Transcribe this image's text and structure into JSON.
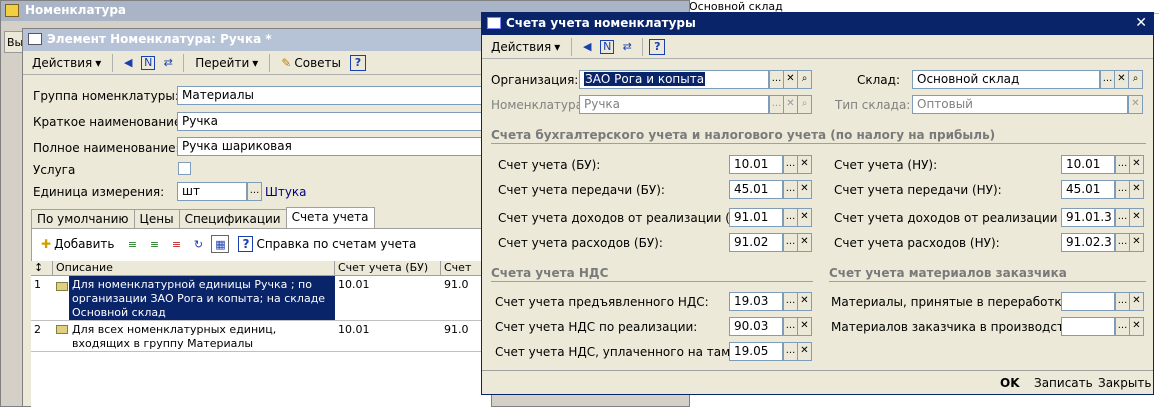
{
  "bg_window": {
    "title": "Номенклатура",
    "menu_partial": "Вы",
    "right_cell": "Основной склад"
  },
  "element_window": {
    "title": "Элемент Номенклатура: Ручка *",
    "toolbar": {
      "actions_label": "Действия",
      "goto_label": "Перейти",
      "tips_label": "Советы"
    },
    "fields": {
      "group_label": "Группа номенклатуры:",
      "group_value": "Материалы",
      "short_name_label": "Краткое наименование:",
      "short_name_value": "Ручка",
      "full_name_label": "Полное наименование:",
      "full_name_value": "Ручка шариковая",
      "service_label": "Услуга",
      "unit_label": "Единица измерения:",
      "unit_value": "шт",
      "unit_name": "Штука"
    },
    "tabs": [
      "По умолчанию",
      "Цены",
      "Спецификации",
      "Счета учета"
    ],
    "active_tab": 3,
    "accounts_toolbar": {
      "add_label": "Добавить",
      "help_label": "Справка по счетам учета"
    },
    "table": {
      "headers": [
        "Описание",
        "Счет учета (БУ)",
        "Счет"
      ],
      "rows": [
        {
          "num": "1",
          "desc": "Для номенклатурной единицы Ручка ; по организации ЗАО Рога и копыта; на складе Основной склад",
          "bu": "10.01",
          "nu": "91.0"
        },
        {
          "num": "2",
          "desc": "Для всех номенклатурных единиц, входящих в группу Материалы",
          "bu": "10.01",
          "nu": "91.0"
        }
      ]
    }
  },
  "dialog": {
    "title": "Счета учета номенклатуры",
    "toolbar": {
      "actions_label": "Действия"
    },
    "org_label": "Организация:",
    "org_value": "ЗАО Рога и копыта",
    "nom_label": "Номенклатура:",
    "nom_value": "Ручка",
    "warehouse_label": "Склад:",
    "warehouse_value": "Основной склад",
    "warehouse_type_label": "Тип склада:",
    "warehouse_type_value": "Оптовый",
    "section_accounting": "Счета бухгалтерского учета и налогового учета (по налогу на прибыль)",
    "bu_rows": [
      {
        "label": "Счет учета (БУ):",
        "value": "10.01"
      },
      {
        "label": "Счет учета передачи (БУ):",
        "value": "45.01"
      },
      {
        "label": "Счет учета доходов от реализации (БУ):",
        "value": "91.01"
      },
      {
        "label": "Счет учета расходов (БУ):",
        "value": "91.02"
      }
    ],
    "nu_rows": [
      {
        "label": "Счет учета (НУ):",
        "value": "10.01"
      },
      {
        "label": "Счет учета передачи (НУ):",
        "value": "45.01"
      },
      {
        "label": "Счет учета доходов от реализации (НУ):",
        "value": "91.01.3"
      },
      {
        "label": "Счет учета расходов (НУ):",
        "value": "91.02.3"
      }
    ],
    "section_vat": "Счета учета НДС",
    "vat_rows": [
      {
        "label": "Счет учета предъявленного НДС:",
        "value": "19.03"
      },
      {
        "label": "Счет учета НДС по реализации:",
        "value": "90.03"
      },
      {
        "label": "Счет учета НДС, уплаченного на таможне:",
        "value": "19.05"
      }
    ],
    "section_customer": "Счет учета материалов заказчика",
    "customer_rows": [
      {
        "label": "Материалы, принятые в переработку:",
        "value": ""
      },
      {
        "label": "Материалов заказчика в производстве:",
        "value": ""
      }
    ],
    "buttons": {
      "ok": "OK",
      "save": "Записать",
      "close": "Закрыть"
    }
  },
  "icon_glyphs": {
    "ellipsis": "...",
    "clear": "✕",
    "search": "⌕",
    "help": "?",
    "dropdown": "▾",
    "close": "✕"
  }
}
